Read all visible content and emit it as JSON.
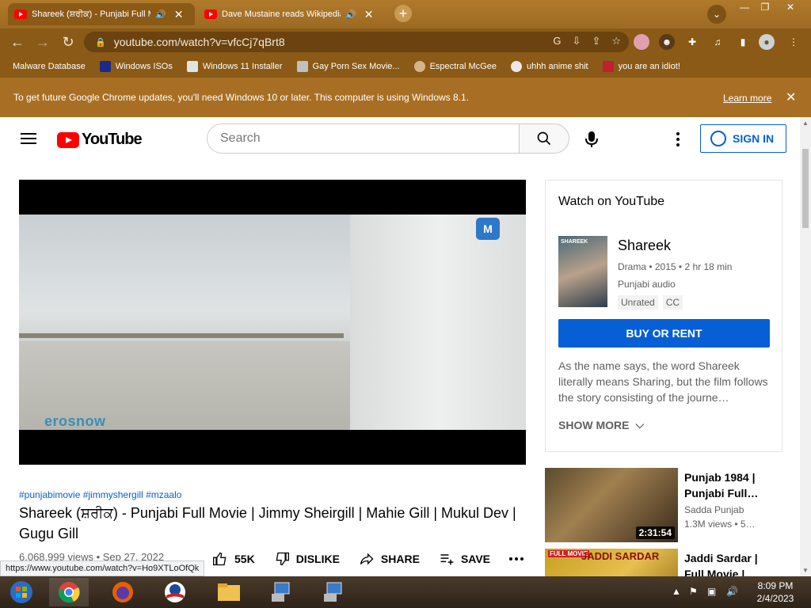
{
  "browser": {
    "tabs": [
      {
        "title": "Shareek (ਸ਼ਰੀਕ) - Punjabi Full Movie",
        "active": true
      },
      {
        "title": "Dave Mustaine reads Wikipedia",
        "active": false
      }
    ],
    "url": "youtube.com/watch?v=vfcCj7qBrt8",
    "bookmarks": [
      {
        "label": "Malware Database"
      },
      {
        "label": "Windows ISOs"
      },
      {
        "label": "Windows 11 Installer"
      },
      {
        "label": "Gay Porn Sex Movie..."
      },
      {
        "label": "Espectral McGee"
      },
      {
        "label": "uhhh anime shit"
      },
      {
        "label": "you are an idiot!"
      }
    ],
    "infobar": {
      "message": "To get future Google Chrome updates, you'll need Windows 10 or later. This computer is using Windows 8.1.",
      "link": "Learn more"
    },
    "status_link": "https://www.youtube.com/watch?v=Ho9XTLoOfQk"
  },
  "youtube": {
    "logo_text": "YouTube",
    "search_placeholder": "Search",
    "sign_in": "SIGN IN",
    "video": {
      "watermark": "erosnow",
      "channel_badge": "M",
      "hashtags": "#punjabimovie #jimmyshergill #mzaalo",
      "title": "Shareek (ਸ਼ਰੀਕ) - Punjabi Full Movie | Jimmy Sheirgill | Mahie Gill | Mukul Dev | Gugu Gill",
      "views_date": "6,068,999 views • Sep 27, 2022",
      "likes": "55K",
      "dislike": "DISLIKE",
      "share": "SHARE",
      "save": "SAVE"
    },
    "watch_card": {
      "heading": "Watch on YouTube",
      "poster_text": "SHAREEK",
      "title": "Shareek",
      "meta": "Drama • 2015 • 2 hr 18 min",
      "audio": "Punjabi audio",
      "badges": [
        "Unrated",
        "CC"
      ],
      "buy": "BUY OR RENT",
      "description": "As the name says, the word Shareek literally means Sharing, but the film follows the story consisting of the journe…",
      "show_more": "SHOW MORE"
    },
    "recommendations": [
      {
        "title": "Punjab 1984 | Punjabi Full…",
        "channel": "Sadda Punjab",
        "views": "1.3M views  •  5…",
        "duration": "2:31:54"
      },
      {
        "title": "Jaddi Sardar | Full Movie |…",
        "channel": "",
        "views": "",
        "duration": "",
        "thumb_tag": "FULL MOVIE",
        "thumb_text": "JADDI SARDAR"
      }
    ]
  },
  "taskbar": {
    "time": "8:09 PM",
    "date": "2/4/2023"
  },
  "colors": {
    "chrome_frame": "#8a5a16",
    "youtube_red": "#ff0000",
    "link_blue": "#065fd4"
  }
}
